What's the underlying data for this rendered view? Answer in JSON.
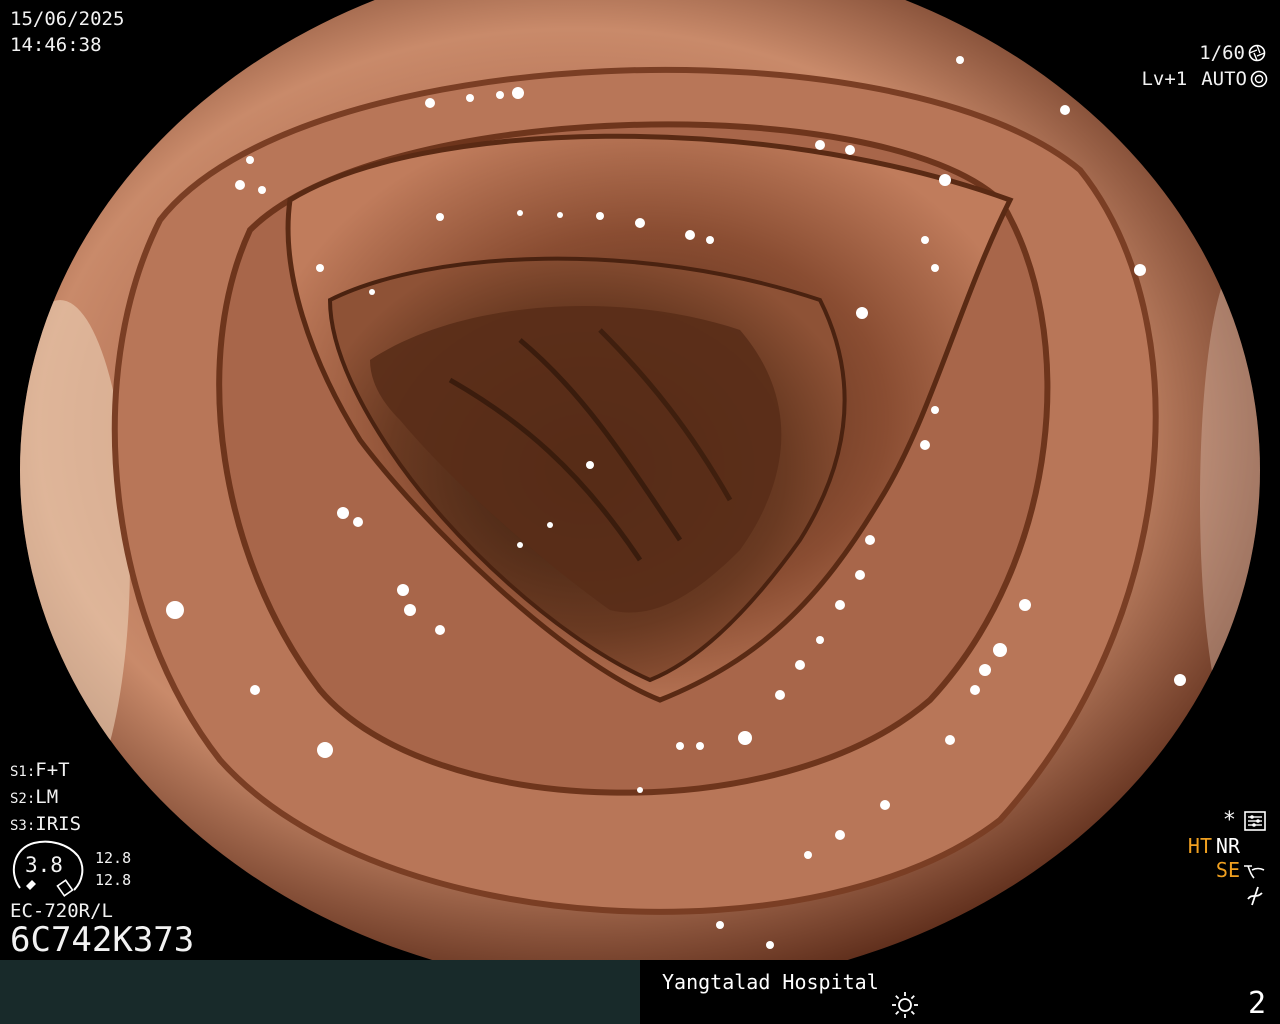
{
  "overlay": {
    "date": "15/06/2025",
    "time": "14:46:38",
    "shutter": "1/60",
    "level": "Lv+1",
    "auto": "AUTO",
    "settings": [
      {
        "key": "S1:",
        "value": "F+T"
      },
      {
        "key": "S2:",
        "value": "LM"
      },
      {
        "key": "S3:",
        "value": "IRIS"
      }
    ],
    "gauge_value": "3.8",
    "gauge_top": "12.8",
    "gauge_bottom": "12.8",
    "scope_model": "EC-720R/L",
    "scope_serial": "6C742K373",
    "asterisk": "*",
    "ht": "HT",
    "nr": "NR",
    "se": "SE"
  },
  "footer": {
    "hospital": "Yangtalad Hospital",
    "page": "2"
  },
  "colors": {
    "amber": "#f0a020",
    "footer_left": "#182a2a",
    "footer_right": "#000000"
  },
  "icons": [
    "aperture-icon",
    "iris-icon",
    "settings-icon",
    "se-curve-icon",
    "not-equal-icon",
    "brightness-sun-icon",
    "gauge-icon"
  ]
}
